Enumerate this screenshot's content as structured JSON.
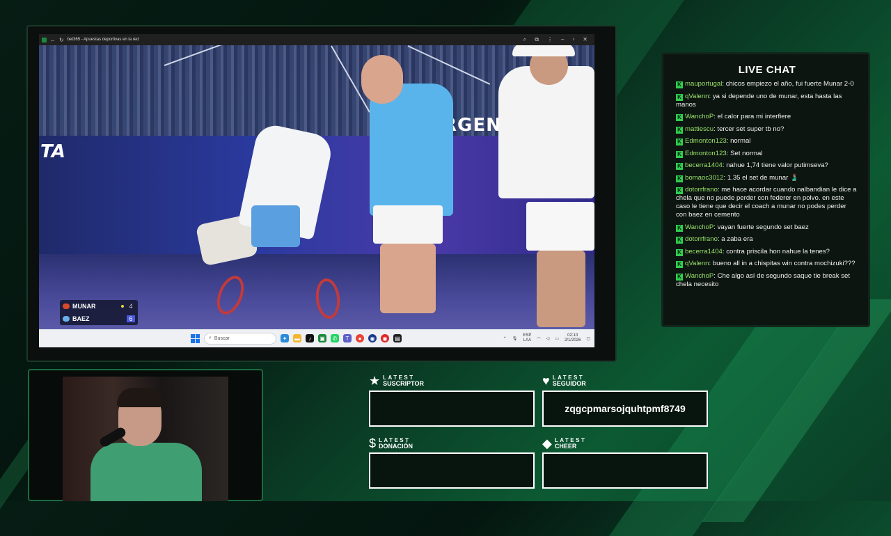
{
  "browser": {
    "title": "bet365 - Apuestas deportivas en la red"
  },
  "video": {
    "banner_right": "RGENTI",
    "banner_left": "TA",
    "scoreboard": [
      {
        "name": "MUNAR",
        "score": "4",
        "flag": "#d84a2a",
        "serving": true
      },
      {
        "name": "BAEZ",
        "score": "6",
        "flag": "#6ab0e8",
        "serving": false
      }
    ]
  },
  "taskbar": {
    "search_placeholder": "Buscar",
    "lang_top": "ESP",
    "lang_bottom": "LAA",
    "time": "02:10",
    "date": "2/1/2026"
  },
  "chat": {
    "title": "LIVE CHAT",
    "messages": [
      {
        "user": "mauportugal",
        "text": "chicos empiezo el año, fui fuerte Munar 2-0"
      },
      {
        "user": "qValenn",
        "text": "ya si depende uno de munar, esta hasta las manos"
      },
      {
        "user": "WanchoP",
        "text": "el calor para mi interfiere"
      },
      {
        "user": "mattiescu",
        "text": "tercer set super tb no?"
      },
      {
        "user": "Edmonton123",
        "text": "normal"
      },
      {
        "user": "Edmonton123",
        "text": "Set normal"
      },
      {
        "user": "becerra1404",
        "text": "nahue 1,74 tiene valor putimseva?"
      },
      {
        "user": "bomaoc3012",
        "text": "1.35 el set de munar 🫃🏽"
      },
      {
        "user": "dotorrfrano",
        "text": "me hace acordar cuando nalbandian le dice a chela que no puede perder con federer en polvo. en este caso le tiene que decir el coach a munar no podes perder con baez en cemento"
      },
      {
        "user": "WanchoP",
        "text": "vayan fuerte segundo set baez"
      },
      {
        "user": "dotorrfrano",
        "text": "a zaba era"
      },
      {
        "user": "becerra1404",
        "text": "contra priscila hon nahue la tenes?"
      },
      {
        "user": "qValenn",
        "text": "bueno all in a chispitas win contra mochizuki???"
      },
      {
        "user": "WanchoP",
        "text": "Che algo así de segundo saque tie break set chela necesito"
      }
    ]
  },
  "alerts": {
    "suscriptor": {
      "top": "LATEST",
      "bottom": "SUSCRIPTOR",
      "icon": "★",
      "value": ""
    },
    "seguidor": {
      "top": "LATEST",
      "bottom": "SEGUIDOR",
      "icon": "♥",
      "value": "zqgcpmarsojquhtpmf8749"
    },
    "donacion": {
      "top": "LATEST",
      "bottom": "DONACIÓN",
      "icon": "$",
      "value": ""
    },
    "cheer": {
      "top": "LATEST",
      "bottom": "CHEER",
      "icon": "◆",
      "value": ""
    }
  }
}
